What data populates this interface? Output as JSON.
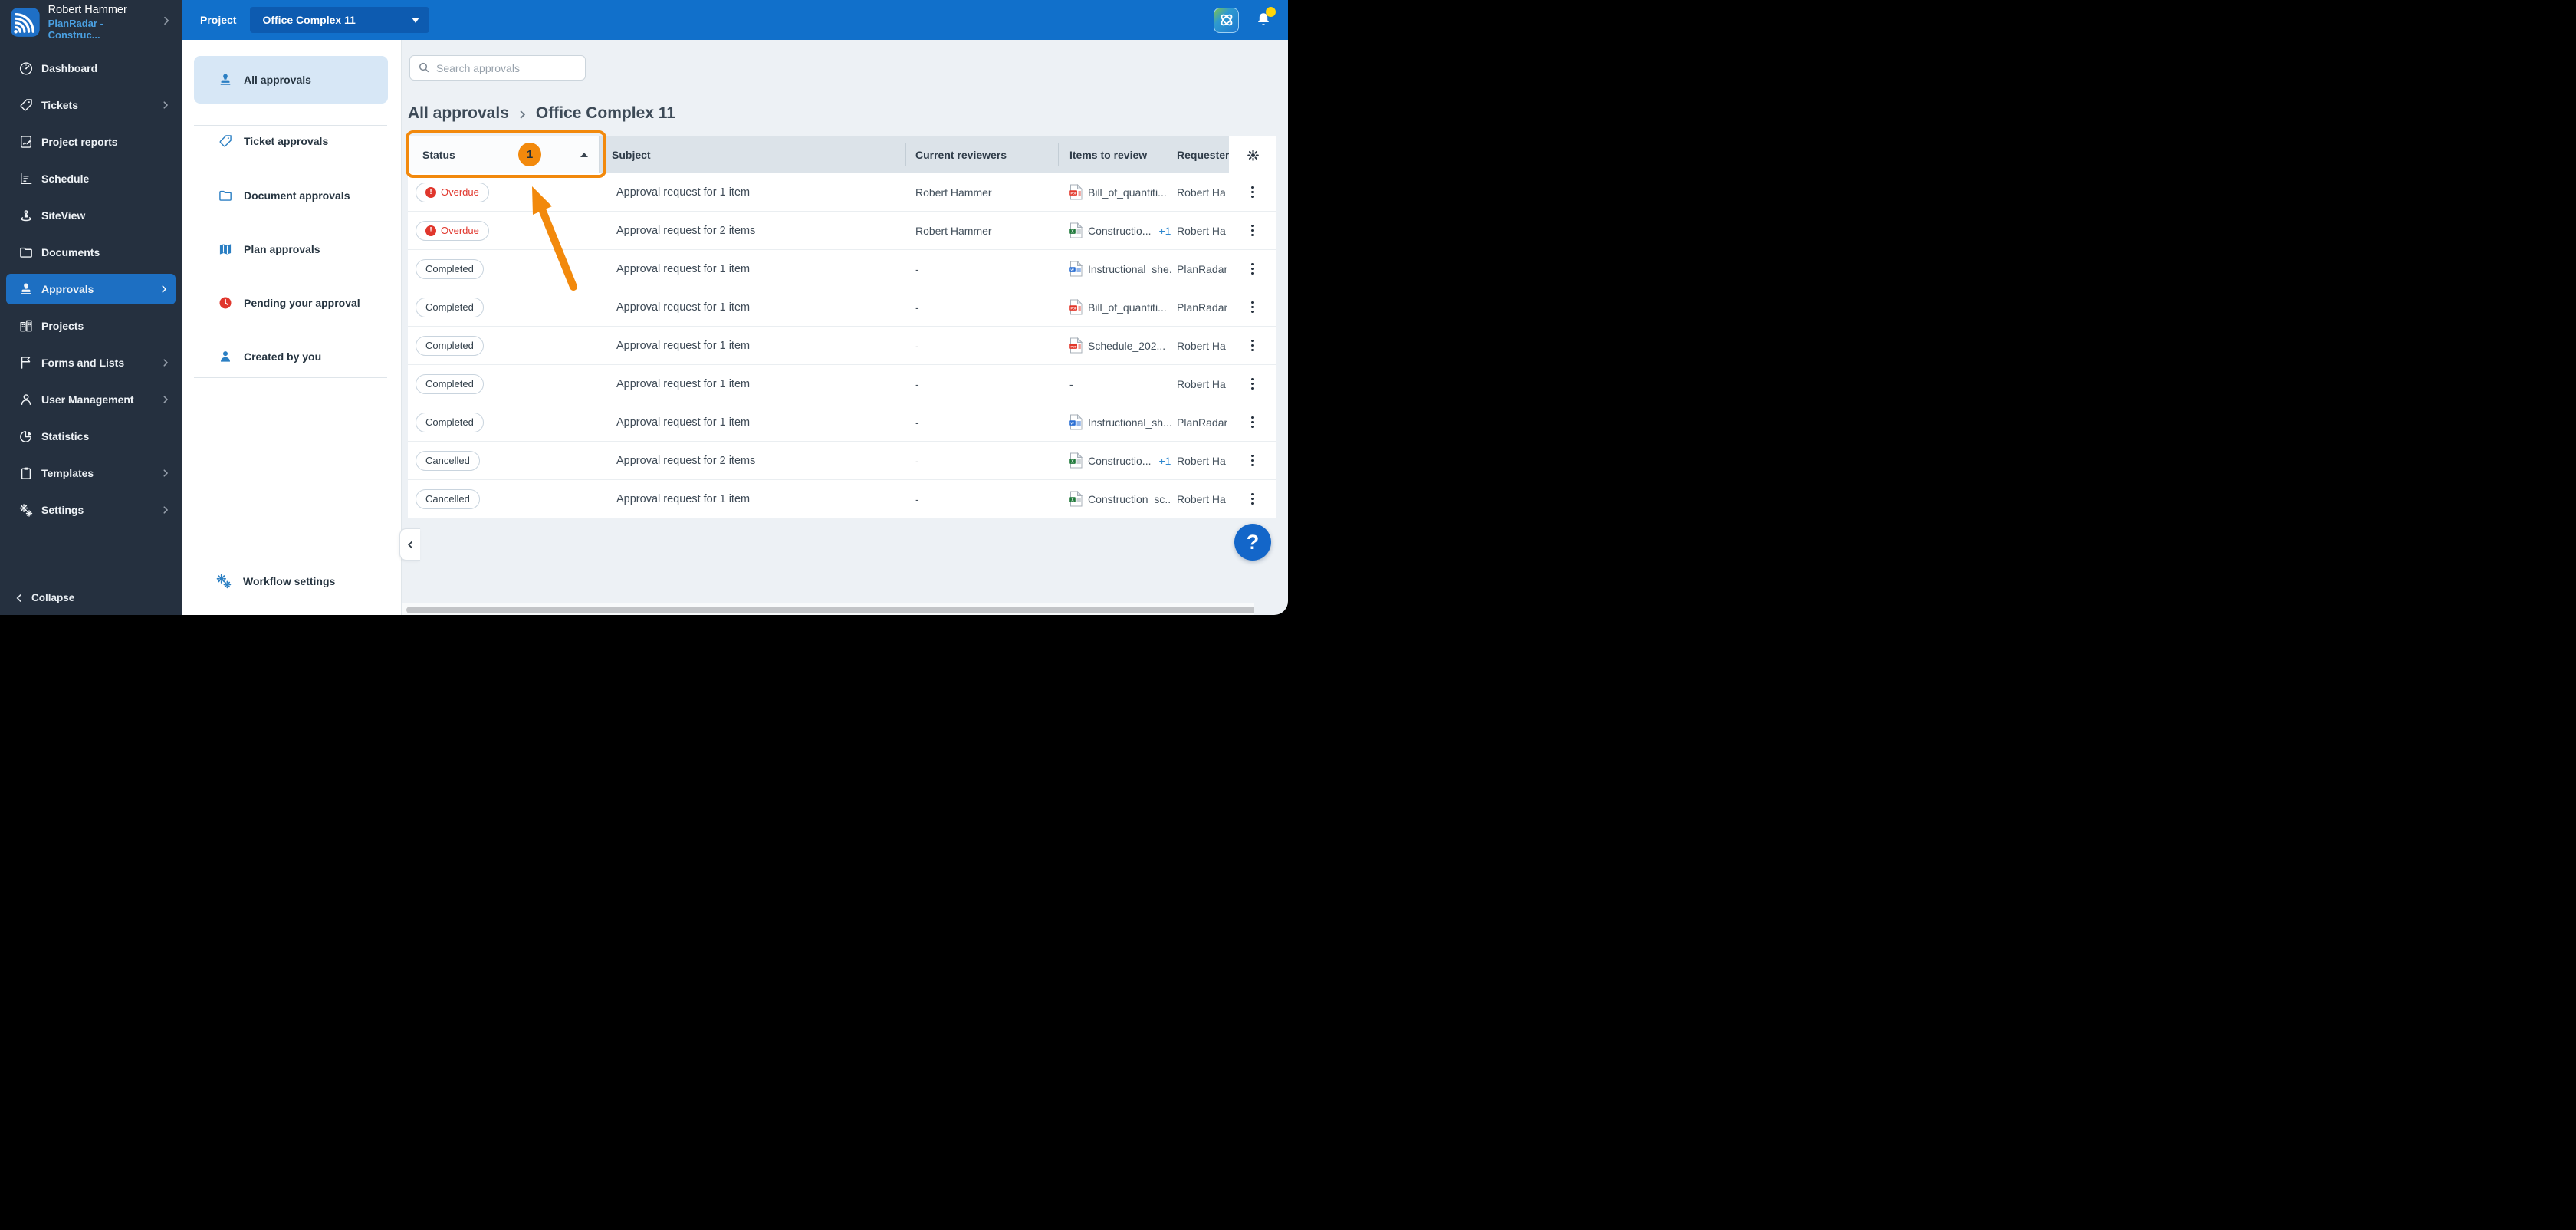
{
  "topbar": {
    "project_label": "Project",
    "project_value": "Office Complex 11"
  },
  "user": {
    "name": "Robert Hammer",
    "account": "PlanRadar - Construc..."
  },
  "sidebar": {
    "items": [
      {
        "label": "Dashboard",
        "icon": "dashboard",
        "chevron": false,
        "active": false
      },
      {
        "label": "Tickets",
        "icon": "tag",
        "chevron": true,
        "active": false
      },
      {
        "label": "Project reports",
        "icon": "report",
        "chevron": false,
        "active": false
      },
      {
        "label": "Schedule",
        "icon": "schedule",
        "chevron": false,
        "active": false
      },
      {
        "label": "SiteView",
        "icon": "siteview",
        "chevron": false,
        "active": false
      },
      {
        "label": "Documents",
        "icon": "folder",
        "chevron": false,
        "active": false
      },
      {
        "label": "Approvals",
        "icon": "stamp",
        "chevron": true,
        "active": true
      },
      {
        "label": "Projects",
        "icon": "buildings",
        "chevron": false,
        "active": false
      },
      {
        "label": "Forms and Lists",
        "icon": "flag",
        "chevron": true,
        "active": false
      },
      {
        "label": "User Management",
        "icon": "user",
        "chevron": true,
        "active": false
      },
      {
        "label": "Statistics",
        "icon": "pie",
        "chevron": false,
        "active": false
      },
      {
        "label": "Templates",
        "icon": "clipboard",
        "chevron": true,
        "active": false
      },
      {
        "label": "Settings",
        "icon": "gears",
        "chevron": true,
        "active": false
      }
    ],
    "collapse_label": "Collapse"
  },
  "approvals_nav": {
    "items": [
      {
        "label": "All approvals",
        "icon": "stamp",
        "active": true
      },
      {
        "label": "Ticket approvals",
        "icon": "tag",
        "active": false
      },
      {
        "label": "Document approvals",
        "icon": "folder",
        "active": false
      },
      {
        "label": "Plan approvals",
        "icon": "map",
        "active": false
      },
      {
        "label": "Pending your approval",
        "icon": "clock",
        "active": false
      },
      {
        "label": "Created by you",
        "icon": "person",
        "active": false
      }
    ],
    "workflow_label": "Workflow settings"
  },
  "search": {
    "placeholder": "Search approvals"
  },
  "breadcrumb": {
    "items": [
      "All approvals",
      "Office Complex 11"
    ]
  },
  "table": {
    "columns": [
      "Status",
      "Subject",
      "Current reviewers",
      "Items to review",
      "Requester"
    ],
    "status_filter_count": "1",
    "sort": "asc",
    "rows": [
      {
        "status": "Overdue",
        "subject": "Approval request for 1 item",
        "reviewer": "Robert Hammer",
        "item": {
          "type": "pdf",
          "name": "Bill_of_quantiti..."
        },
        "extra": "",
        "requester": "Robert Ha"
      },
      {
        "status": "Overdue",
        "subject": "Approval request for 2 items",
        "reviewer": "Robert Hammer",
        "item": {
          "type": "xls",
          "name": "Constructio..."
        },
        "extra": "+1",
        "requester": "Robert Ha"
      },
      {
        "status": "Completed",
        "subject": "Approval request for 1 item",
        "reviewer": "-",
        "item": {
          "type": "doc",
          "name": "Instructional_she..."
        },
        "extra": "",
        "requester": "PlanRadar"
      },
      {
        "status": "Completed",
        "subject": "Approval request for 1 item",
        "reviewer": "-",
        "item": {
          "type": "pdf",
          "name": "Bill_of_quantiti..."
        },
        "extra": "",
        "requester": "PlanRadar"
      },
      {
        "status": "Completed",
        "subject": "Approval request for 1 item",
        "reviewer": "-",
        "item": {
          "type": "pdf",
          "name": "Schedule_202..."
        },
        "extra": "",
        "requester": "Robert Ha"
      },
      {
        "status": "Completed",
        "subject": "Approval request for 1 item",
        "reviewer": "-",
        "item": null,
        "extra": "",
        "requester": "Robert Ha"
      },
      {
        "status": "Completed",
        "subject": "Approval request for 1 item",
        "reviewer": "-",
        "item": {
          "type": "doc",
          "name": "Instructional_sh..."
        },
        "extra": "",
        "requester": "PlanRadar"
      },
      {
        "status": "Cancelled",
        "subject": "Approval request for 2 items",
        "reviewer": "-",
        "item": {
          "type": "xls",
          "name": "Constructio..."
        },
        "extra": "+1",
        "requester": "Robert Ha"
      },
      {
        "status": "Cancelled",
        "subject": "Approval request for 1 item",
        "reviewer": "-",
        "item": {
          "type": "xls",
          "name": "Construction_sc..."
        },
        "extra": "",
        "requester": "Robert Ha"
      }
    ]
  },
  "help": {
    "label": "?"
  },
  "colors": {
    "topbar_blue": "#1170cb",
    "sidebar_dark": "#25303f",
    "active_blue": "#1d6fc2",
    "accent_icon_blue": "#2b7fc3",
    "annotation_orange": "#f2890c",
    "overdue_red": "#e0362c",
    "link_blue": "#2f88cf",
    "help_blue": "#1366c9",
    "pdf_red": "#e2372b",
    "xls_green": "#217a3c",
    "doc_blue": "#2b6fd4"
  }
}
